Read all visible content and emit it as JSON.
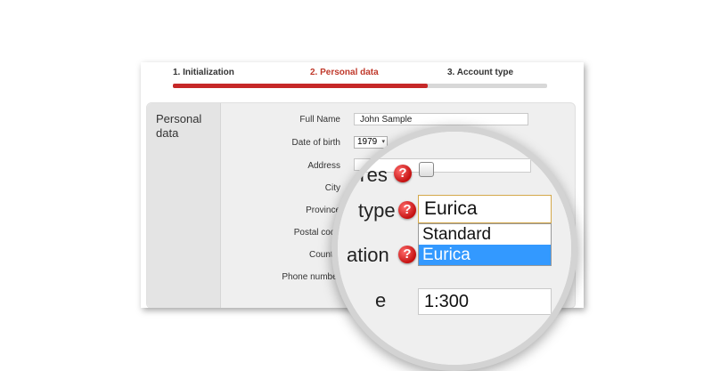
{
  "steps": [
    {
      "label": "1. Initialization"
    },
    {
      "label": "2. Personal data"
    },
    {
      "label": "3. Account type"
    }
  ],
  "progress": 0.68,
  "colors": {
    "accent": "#c62828",
    "selected": "#3399ff",
    "help": "#c41010"
  },
  "panel": {
    "title": "Personal data"
  },
  "form": {
    "labels": [
      "Full Name",
      "Date of birth",
      "Address",
      "City",
      "Province",
      "Postal code",
      "Country",
      "Phone number"
    ],
    "full_name_value": "John Sample",
    "birth_year": "1979"
  },
  "magnifier": {
    "label_yes": "Yes",
    "label_type": "type",
    "label_location": "ation",
    "label_scale": "e",
    "help_glyph": "?",
    "combo_value": "Eurica",
    "options": [
      "Standard",
      "Eurica"
    ],
    "selected_option": "Eurica",
    "scale_value": "1:300"
  },
  "icons": [
    "help-icon",
    "checkbox-icon",
    "dropdown-arrow-icon"
  ]
}
